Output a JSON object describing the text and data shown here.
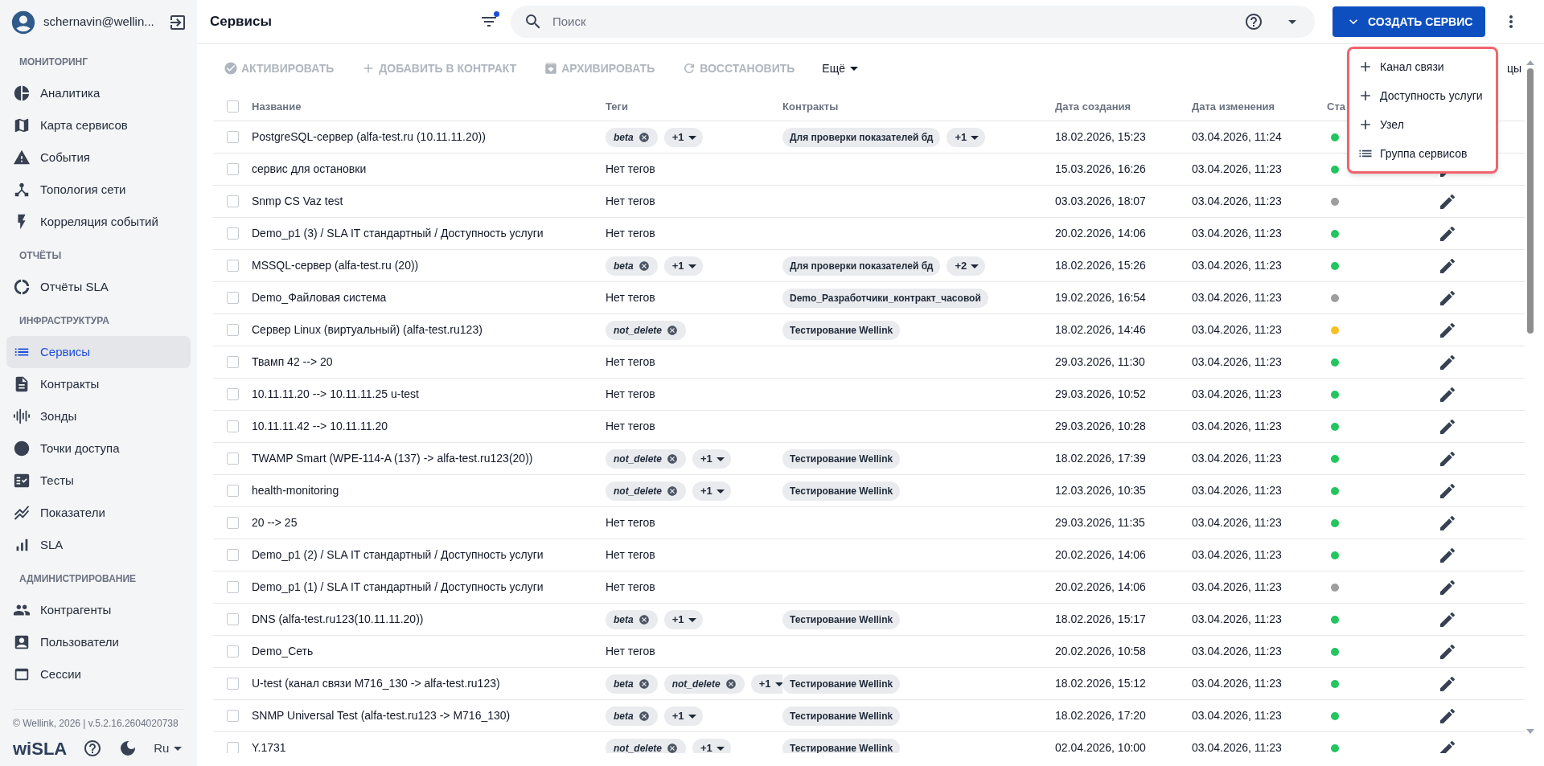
{
  "user": {
    "name": "schernavin@wellin..."
  },
  "sidebar": {
    "sections": [
      {
        "title": "МОНИТОРИНГ",
        "items": [
          {
            "label": "Аналитика",
            "selected": false
          },
          {
            "label": "Карта сервисов",
            "selected": false
          },
          {
            "label": "События",
            "selected": false
          },
          {
            "label": "Топология сети",
            "selected": false
          },
          {
            "label": "Корреляция событий",
            "selected": false
          }
        ]
      },
      {
        "title": "ОТЧЁТЫ",
        "items": [
          {
            "label": "Отчёты SLA",
            "selected": false
          }
        ]
      },
      {
        "title": "ИНФРАСТРУКТУРА",
        "items": [
          {
            "label": "Сервисы",
            "selected": true
          },
          {
            "label": "Контракты",
            "selected": false
          },
          {
            "label": "Зонды",
            "selected": false
          },
          {
            "label": "Точки доступа",
            "selected": false
          },
          {
            "label": "Тесты",
            "selected": false
          },
          {
            "label": "Показатели",
            "selected": false
          },
          {
            "label": "SLA",
            "selected": false
          }
        ]
      },
      {
        "title": "АДМИНИСТРИРОВАНИЕ",
        "items": [
          {
            "label": "Контрагенты",
            "selected": false
          },
          {
            "label": "Пользователи",
            "selected": false
          },
          {
            "label": "Сессии",
            "selected": false
          }
        ]
      }
    ],
    "footer": {
      "copyright": "© Wellink, 2026 | v.5.2.16.2604020738",
      "logo": "wiSLA",
      "language": "Ru"
    }
  },
  "header": {
    "title": "Сервисы",
    "filter_active": true,
    "search": {
      "placeholder": "Поиск"
    },
    "create_button": "СОЗДАТЬ СЕРВИС"
  },
  "create_menu": [
    {
      "kind": "add",
      "label": "Канал связи"
    },
    {
      "kind": "add",
      "label": "Доступность услуги"
    },
    {
      "kind": "add",
      "label": "Узел"
    },
    {
      "kind": "list",
      "label": "Группа сервисов"
    }
  ],
  "toolbar": {
    "actions": [
      {
        "kind": "check",
        "label": "АКТИВИРОВАТЬ",
        "disabled": true
      },
      {
        "kind": "add",
        "label": "ДОБАВИТЬ В КОНТРАКТ",
        "disabled": true
      },
      {
        "kind": "archive",
        "label": "АРХИВИРОВАТЬ",
        "disabled": true
      },
      {
        "kind": "restore",
        "label": "ВОССТАНОВИТЬ",
        "disabled": true
      }
    ],
    "more": "Ещё",
    "right_text": "цы"
  },
  "table": {
    "columns": [
      "Название",
      "Теги",
      "Контракты",
      "Дата создания",
      "Дата изменения",
      "Ста"
    ],
    "select_all_checked": false,
    "rows": [
      {
        "checked": false,
        "name": "PostgreSQL-сервер (alfa-test.ru (10.11.11.20))",
        "tags": [
          "beta"
        ],
        "tags_more": "+1",
        "contracts": [
          "Для проверки показателей бд"
        ],
        "contracts_more": "+1",
        "created": "18.02.2026, 15:23",
        "modified": "03.04.2026, 11:24",
        "color": "#22c55e"
      },
      {
        "checked": false,
        "name": "сервис для остановки",
        "tags": [],
        "tags_text": "Нет тегов",
        "contracts": [],
        "created": "15.03.2026, 16:26",
        "modified": "03.04.2026, 11:23",
        "color": "#22c55e"
      },
      {
        "checked": false,
        "name": "Snmp CS Vaz test",
        "tags": [],
        "tags_text": "Нет тегов",
        "contracts": [],
        "created": "03.03.2026, 18:07",
        "modified": "03.04.2026, 11:23",
        "color": "#9e9e9e"
      },
      {
        "checked": false,
        "name": "Demo_p1 (3) / SLA IT стандартный / Доступность услуги",
        "tags": [],
        "tags_text": "Нет тегов",
        "contracts": [],
        "created": "20.02.2026, 14:06",
        "modified": "03.04.2026, 11:23",
        "color": "#22c55e"
      },
      {
        "checked": false,
        "name": "MSSQL-сервер (alfa-test.ru (20))",
        "tags": [
          "beta"
        ],
        "tags_more": "+1",
        "contracts": [
          "Для проверки показателей бд"
        ],
        "contracts_more": "+2",
        "created": "18.02.2026, 15:26",
        "modified": "03.04.2026, 11:23",
        "color": "#22c55e"
      },
      {
        "checked": false,
        "name": "Demo_Файловая система",
        "tags": [],
        "tags_text": "Нет тегов",
        "contracts": [
          "Demo_Разработчики_контракт_часовой"
        ],
        "created": "19.02.2026, 16:54",
        "modified": "03.04.2026, 11:23",
        "color": "#9e9e9e"
      },
      {
        "checked": false,
        "name": "Сервер Linux (виртуальный) (alfa-test.ru123)",
        "tags": [
          "not_delete"
        ],
        "contracts": [
          "Тестирование Wellink"
        ],
        "created": "18.02.2026, 14:46",
        "modified": "03.04.2026, 11:23",
        "color": "#fbbf24"
      },
      {
        "checked": false,
        "name": "Твамп 42 --> 20",
        "tags": [],
        "tags_text": "Нет тегов",
        "contracts": [],
        "created": "29.03.2026, 11:30",
        "modified": "03.04.2026, 11:23",
        "color": "#22c55e"
      },
      {
        "checked": false,
        "name": "10.11.11.20 --> 10.11.11.25 u-test",
        "tags": [],
        "tags_text": "Нет тегов",
        "contracts": [],
        "created": "29.03.2026, 10:52",
        "modified": "03.04.2026, 11:23",
        "color": "#22c55e"
      },
      {
        "checked": false,
        "name": "10.11.11.42 --> 10.11.11.20",
        "tags": [],
        "tags_text": "Нет тегов",
        "contracts": [],
        "created": "29.03.2026, 10:28",
        "modified": "03.04.2026, 11:23",
        "color": "#22c55e"
      },
      {
        "checked": false,
        "name": "TWAMP Smart (WPE-114-A (137) -> alfa-test.ru123(20))",
        "tags": [
          "not_delete"
        ],
        "tags_more": "+1",
        "contracts": [
          "Тестирование Wellink"
        ],
        "created": "18.02.2026, 17:39",
        "modified": "03.04.2026, 11:23",
        "color": "#22c55e"
      },
      {
        "checked": false,
        "name": "health-monitoring",
        "tags": [
          "not_delete"
        ],
        "tags_more": "+1",
        "contracts": [
          "Тестирование Wellink"
        ],
        "created": "12.03.2026, 10:35",
        "modified": "03.04.2026, 11:23",
        "color": "#22c55e"
      },
      {
        "checked": false,
        "name": "20 --> 25",
        "tags": [],
        "tags_text": "Нет тегов",
        "contracts": [],
        "created": "29.03.2026, 11:35",
        "modified": "03.04.2026, 11:23",
        "color": "#22c55e"
      },
      {
        "checked": false,
        "name": "Demo_p1 (2) / SLA IT стандартный / Доступность услуги",
        "tags": [],
        "tags_text": "Нет тегов",
        "contracts": [],
        "created": "20.02.2026, 14:06",
        "modified": "03.04.2026, 11:23",
        "color": "#22c55e"
      },
      {
        "checked": false,
        "name": "Demo_p1 (1) / SLA IT стандартный / Доступность услуги",
        "tags": [],
        "tags_text": "Нет тегов",
        "contracts": [],
        "created": "20.02.2026, 14:06",
        "modified": "03.04.2026, 11:23",
        "color": "#9e9e9e"
      },
      {
        "checked": false,
        "name": "DNS (alfa-test.ru123(10.11.11.20))",
        "tags": [
          "beta"
        ],
        "tags_more": "+1",
        "contracts": [
          "Тестирование Wellink"
        ],
        "created": "18.02.2026, 15:17",
        "modified": "03.04.2026, 11:23",
        "color": "#22c55e"
      },
      {
        "checked": false,
        "name": "Demo_Сеть",
        "tags": [],
        "tags_text": "Нет тегов",
        "contracts": [],
        "created": "20.02.2026, 10:58",
        "modified": "03.04.2026, 11:23",
        "color": "#22c55e"
      },
      {
        "checked": false,
        "name": "U-test (канал связи M716_130 -> alfa-test.ru123)",
        "tags": [
          "beta",
          "not_delete"
        ],
        "tags_more": "+1",
        "contracts": [
          "Тестирование Wellink"
        ],
        "created": "18.02.2026, 15:12",
        "modified": "03.04.2026, 11:23",
        "color": "#22c55e"
      },
      {
        "checked": false,
        "name": "SNMP Universal Test (alfa-test.ru123 -> M716_130)",
        "tags": [
          "beta"
        ],
        "tags_more": "+1",
        "contracts": [
          "Тестирование Wellink"
        ],
        "created": "18.02.2026, 17:20",
        "modified": "03.04.2026, 11:23",
        "color": "#22c55e"
      },
      {
        "checked": false,
        "name": "Y.1731",
        "tags": [
          "not_delete"
        ],
        "tags_more": "+1",
        "contracts": [
          "Тестирование Wellink"
        ],
        "created": "02.04.2026, 10:00",
        "modified": "03.04.2026, 11:23",
        "color": "#22c55e"
      }
    ]
  }
}
